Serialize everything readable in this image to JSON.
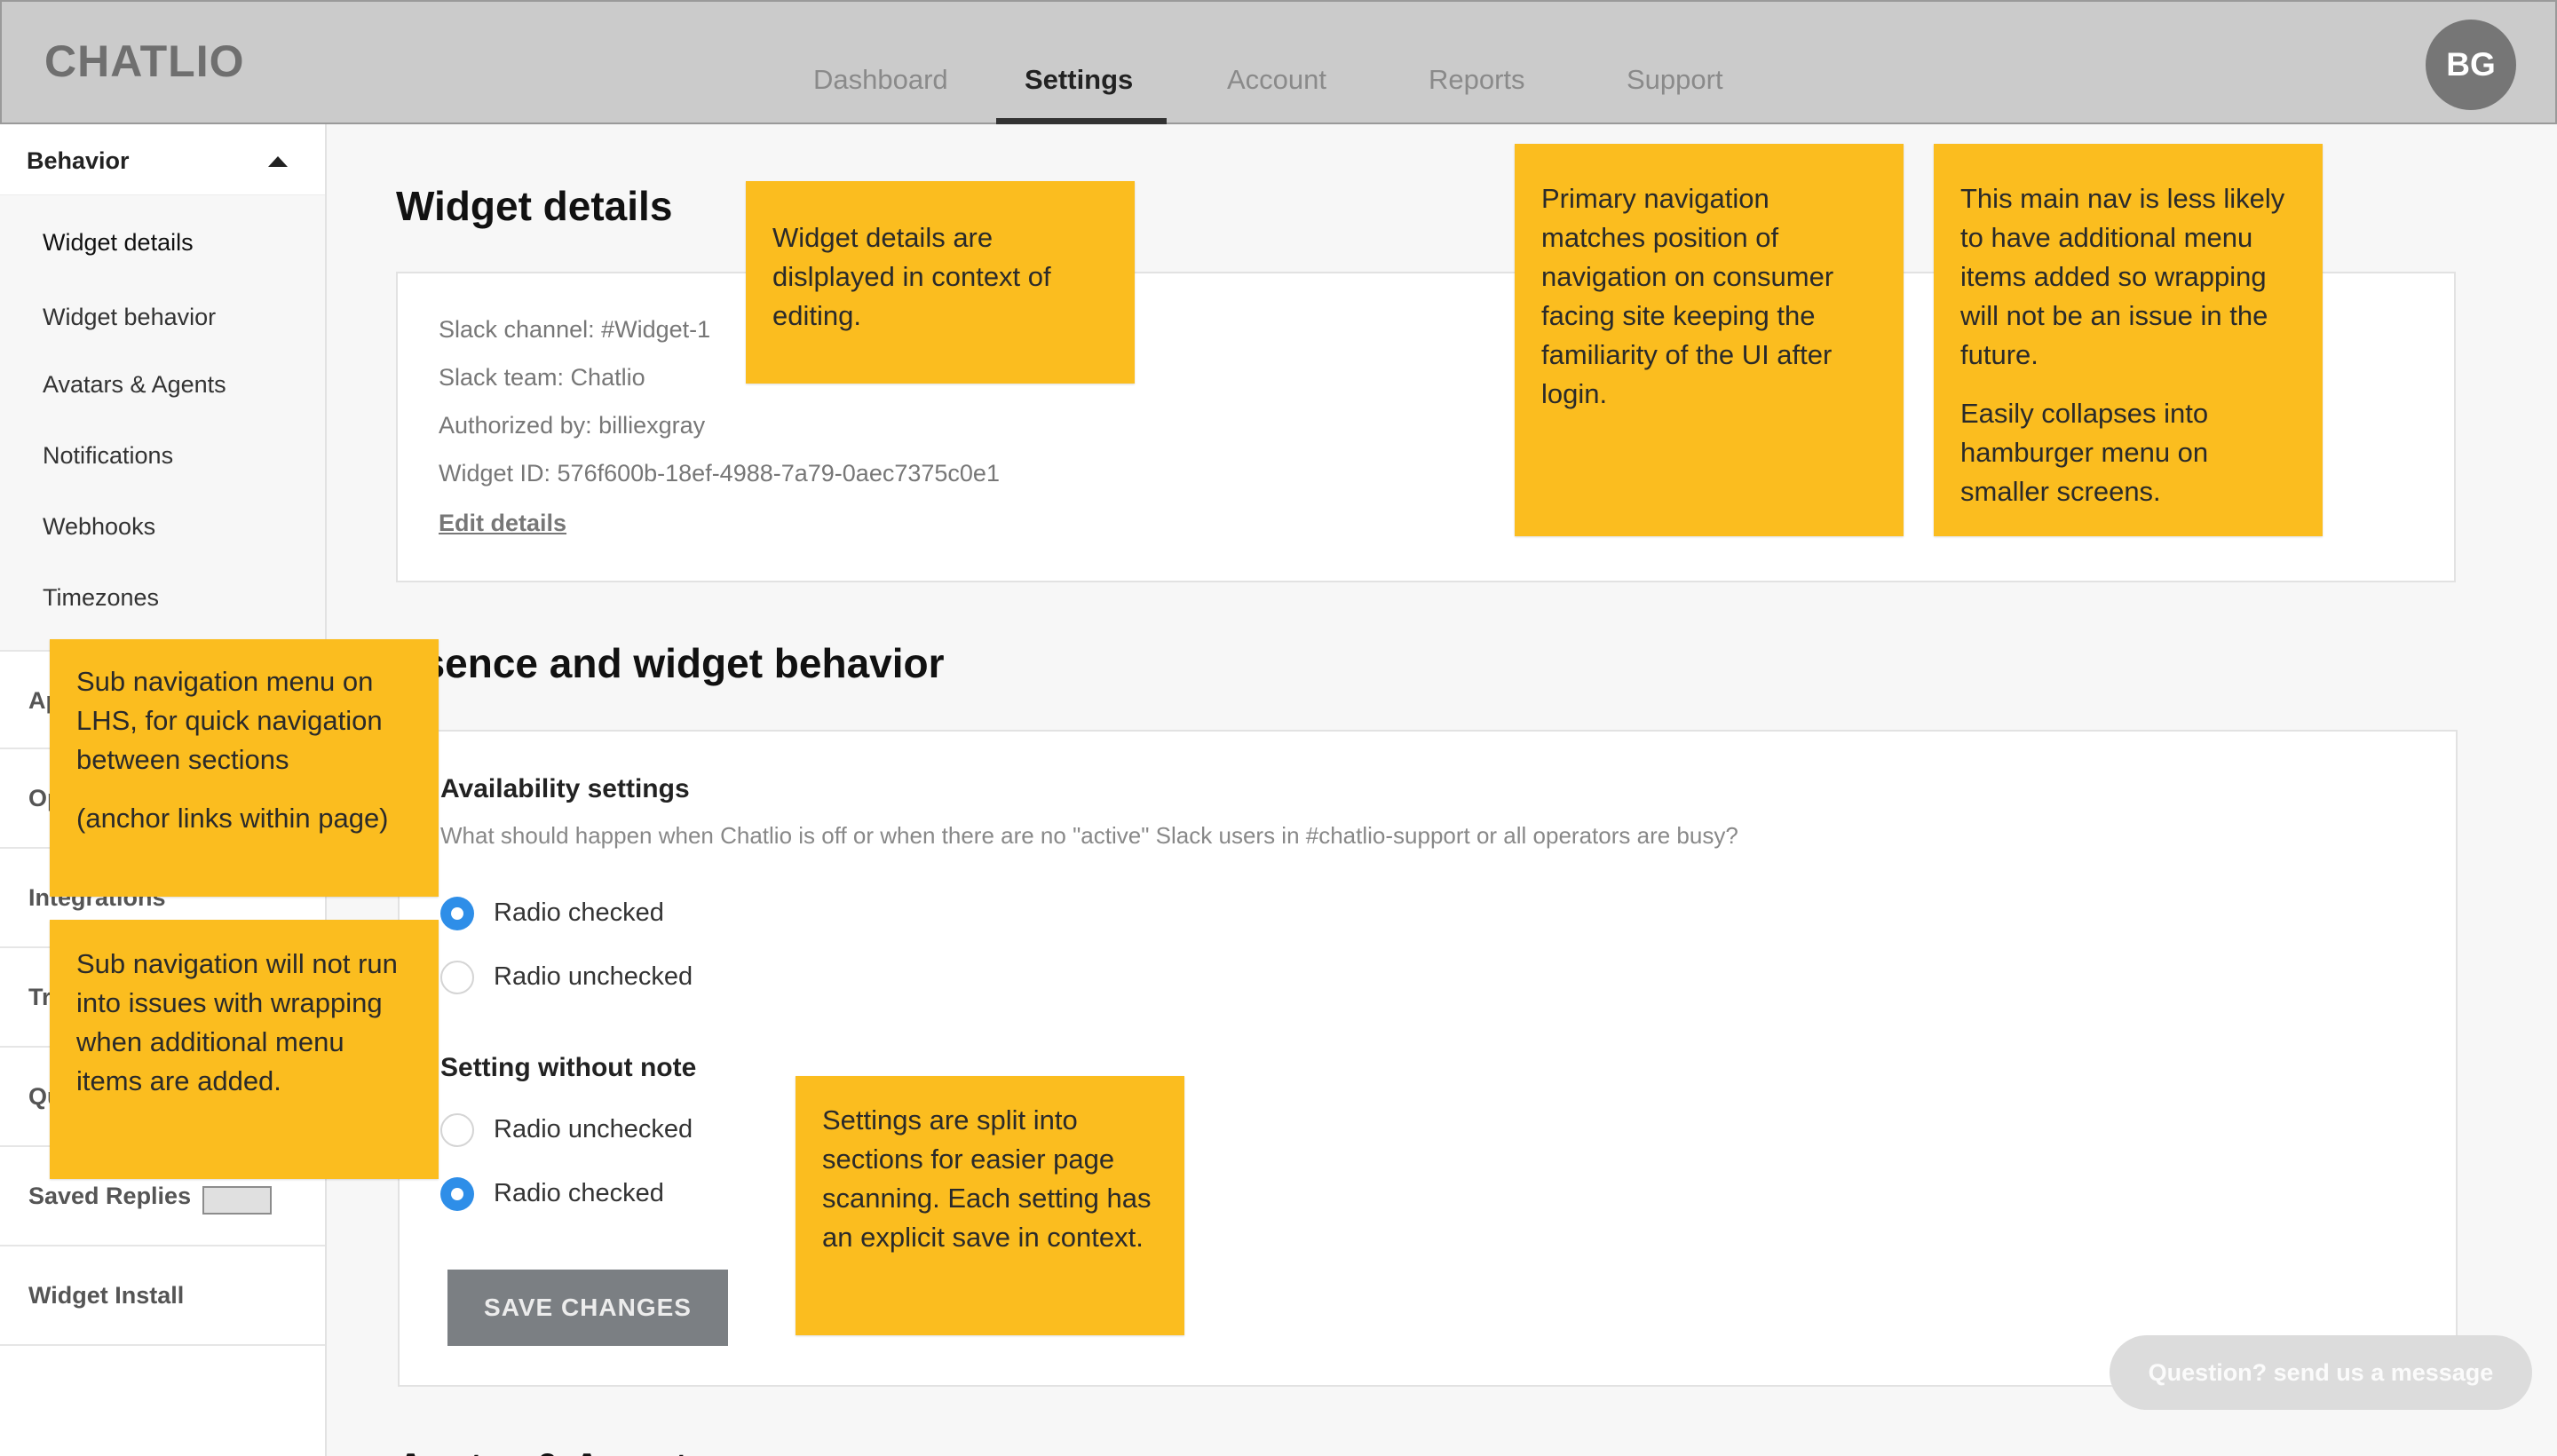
{
  "app": {
    "logo": "CHATLIO",
    "avatar_initials": "BG"
  },
  "nav": {
    "tabs": [
      {
        "label": "Dashboard",
        "active": false
      },
      {
        "label": "Settings",
        "active": true
      },
      {
        "label": "Account",
        "active": false
      },
      {
        "label": "Reports",
        "active": false
      },
      {
        "label": "Support",
        "active": false
      }
    ]
  },
  "sidebar": {
    "section_header": "Behavior",
    "sub_items": [
      "Widget details",
      "Widget behavior",
      "Avatars & Agents",
      "Notifications",
      "Webhooks",
      "Timezones"
    ],
    "sections": [
      {
        "label": "Ap"
      },
      {
        "label": "Op"
      },
      {
        "label": "Integrations"
      },
      {
        "label": "Tr"
      },
      {
        "label": "Qu"
      },
      {
        "label": "Saved Replies"
      },
      {
        "label": "Widget Install"
      }
    ]
  },
  "main": {
    "title": "Widget details",
    "details": {
      "slack_channel": "Slack channel: #Widget-1",
      "slack_team": "Slack team: Chatlio",
      "authorized_by": "Authorized by: billiexgray",
      "widget_id": "Widget ID: 576f600b-18ef-4988-7a79-0aec7375c0e1",
      "edit_link": "Edit details"
    },
    "section2_title": "esence and widget behavior",
    "availability": {
      "title": "Availability settings",
      "description": "What should happen when Chatlio is off or when there are no \"active\" Slack users in #chatlio-support or all operators are busy?",
      "options": [
        {
          "label": "Radio checked",
          "checked": true
        },
        {
          "label": "Radio unchecked",
          "checked": false
        }
      ]
    },
    "setting2": {
      "title": "Setting without note",
      "options": [
        {
          "label": "Radio unchecked",
          "checked": false
        },
        {
          "label": "Radio checked",
          "checked": true
        }
      ]
    },
    "save_button": "SAVE CHANGES",
    "next_heading": "Avatar & Agents"
  },
  "chat_pill": "Question? send us a message",
  "notes": {
    "widget_details": "Widget details are dislplayed in context of editing.",
    "primary_nav": "Primary navigation matches position of navigation on consumer facing site keeping the familiarity of the UI after login.",
    "main_nav_1": "This main nav is less likely to have additional menu items added so wrapping will not be an issue in the future.",
    "main_nav_2": "Easily collapses into hamburger menu on smaller screens.",
    "sub_nav_1": "Sub navigation menu on LHS, for quick navigation between sections",
    "sub_nav_2": "(anchor links within page)",
    "sub_nav_wrap": "Sub navigation will not run into issues with wrapping when additional menu items are added.",
    "settings_split": "Settings are split into sections for easier page scanning. Each setting has an explicit save in context."
  },
  "colors": {
    "topbar": "#cbcbcb",
    "note": "#fbbd1f",
    "radio_checked": "#2e8ee8",
    "save_button": "#7b7f83"
  }
}
